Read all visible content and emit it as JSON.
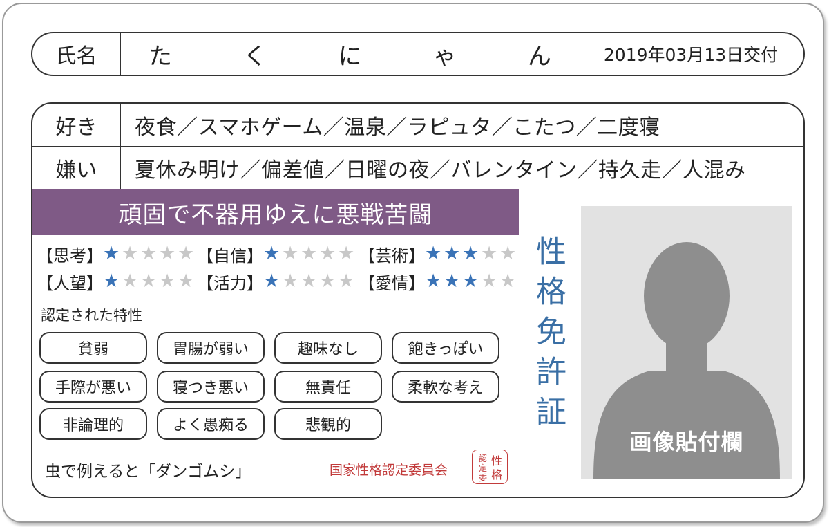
{
  "card": {
    "name_label": "氏名",
    "name_chars": [
      "た",
      "く",
      "に",
      "ゃ",
      "ん"
    ],
    "issue_date": "2019年03月13日交付",
    "likes_label": "好き",
    "likes_value": "夜食／スマホゲーム／温泉／ラピュタ／こたつ／二度寝",
    "dislikes_label": "嫌い",
    "dislikes_value": "夏休み明け／偏差値／日曜の夜／バレンタイン／持久走／人混み",
    "headline": "頑固で不器用ゆえに悪戦苦闘",
    "stats": [
      {
        "label": "【思考】",
        "stars": 1
      },
      {
        "label": "【自信】",
        "stars": 1
      },
      {
        "label": "【芸術】",
        "stars": 3
      },
      {
        "label": "【人望】",
        "stars": 1
      },
      {
        "label": "【活力】",
        "stars": 1
      },
      {
        "label": "【愛情】",
        "stars": 3
      }
    ],
    "star_max": 5,
    "star_on_color": "#3a73b7",
    "star_off_color": "#c8c8c8",
    "traits_heading": "認定された特性",
    "traits": [
      "貧弱",
      "胃腸が弱い",
      "趣味なし",
      "飽きっぽい",
      "手際が悪い",
      "寝つき悪い",
      "無責任",
      "柔軟な考え",
      "非論理的",
      "よく愚痴る",
      "悲観的"
    ],
    "insect_text": "虫で例えると「ダンゴムシ」",
    "committee": "国家性格認定委員会",
    "seal_chars": [
      "性",
      "格",
      "認",
      "定",
      "委"
    ],
    "vertical_title": "性格免許証",
    "photo_label": "画像貼付欄",
    "headline_color": "#7f5a86",
    "title_color": "#3a6fa5",
    "seal_color": "#c23b3b"
  }
}
